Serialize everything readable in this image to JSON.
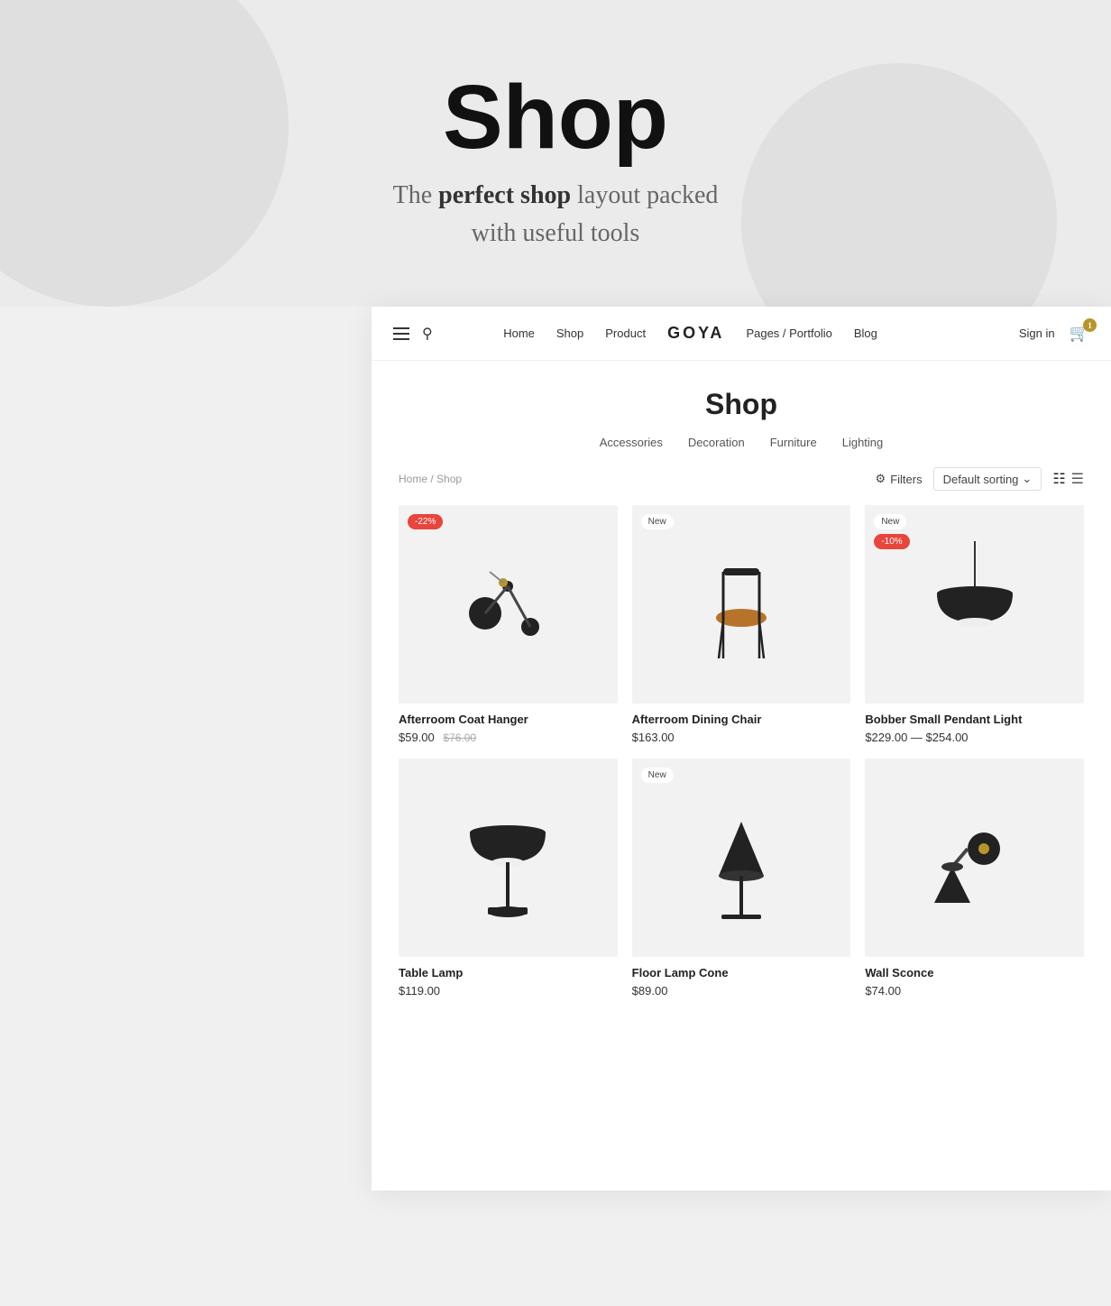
{
  "hero": {
    "title": "Shop",
    "subtitle_normal": "The ",
    "subtitle_bold": "perfect shop",
    "subtitle_end": " layout packed\nwith useful tools"
  },
  "nav": {
    "links": [
      "Home",
      "Shop",
      "Product",
      "Pages / Portfolio",
      "Blog"
    ],
    "logo": "GOYA",
    "signin": "Sign in",
    "cart_count": "1"
  },
  "shop": {
    "title": "Shop",
    "categories": [
      "Accessories",
      "Decoration",
      "Furniture",
      "Lighting"
    ],
    "breadcrumb": "Home / Shop",
    "filter_label": "Filters",
    "sort_label": "Default sorting",
    "products": [
      {
        "id": 1,
        "name": "Afterroom Coat Hanger",
        "price": "$59.00",
        "original_price": "$76.00",
        "badge": "-22%",
        "badge_type": "sale",
        "shape": "coat-hanger"
      },
      {
        "id": 2,
        "name": "Afterroom Dining Chair",
        "price": "$163.00",
        "original_price": "",
        "badge": "New",
        "badge_type": "new",
        "shape": "chair"
      },
      {
        "id": 3,
        "name": "Bobber Small Pendant Light",
        "price": "$229.00 — $254.00",
        "original_price": "",
        "badge": "New",
        "badge_type": "new",
        "badge2": "-10%",
        "badge2_type": "sale",
        "shape": "pendant"
      },
      {
        "id": 4,
        "name": "Table Lamp",
        "price": "$119.00",
        "original_price": "",
        "badge": "",
        "badge_type": "",
        "shape": "table-lamp"
      },
      {
        "id": 5,
        "name": "Floor Lamp Cone",
        "price": "$89.00",
        "original_price": "",
        "badge": "New",
        "badge_type": "new",
        "shape": "cone-lamp"
      },
      {
        "id": 6,
        "name": "Wall Sconce",
        "price": "$74.00",
        "original_price": "",
        "badge": "",
        "badge_type": "",
        "shape": "wall-sconce"
      }
    ]
  }
}
